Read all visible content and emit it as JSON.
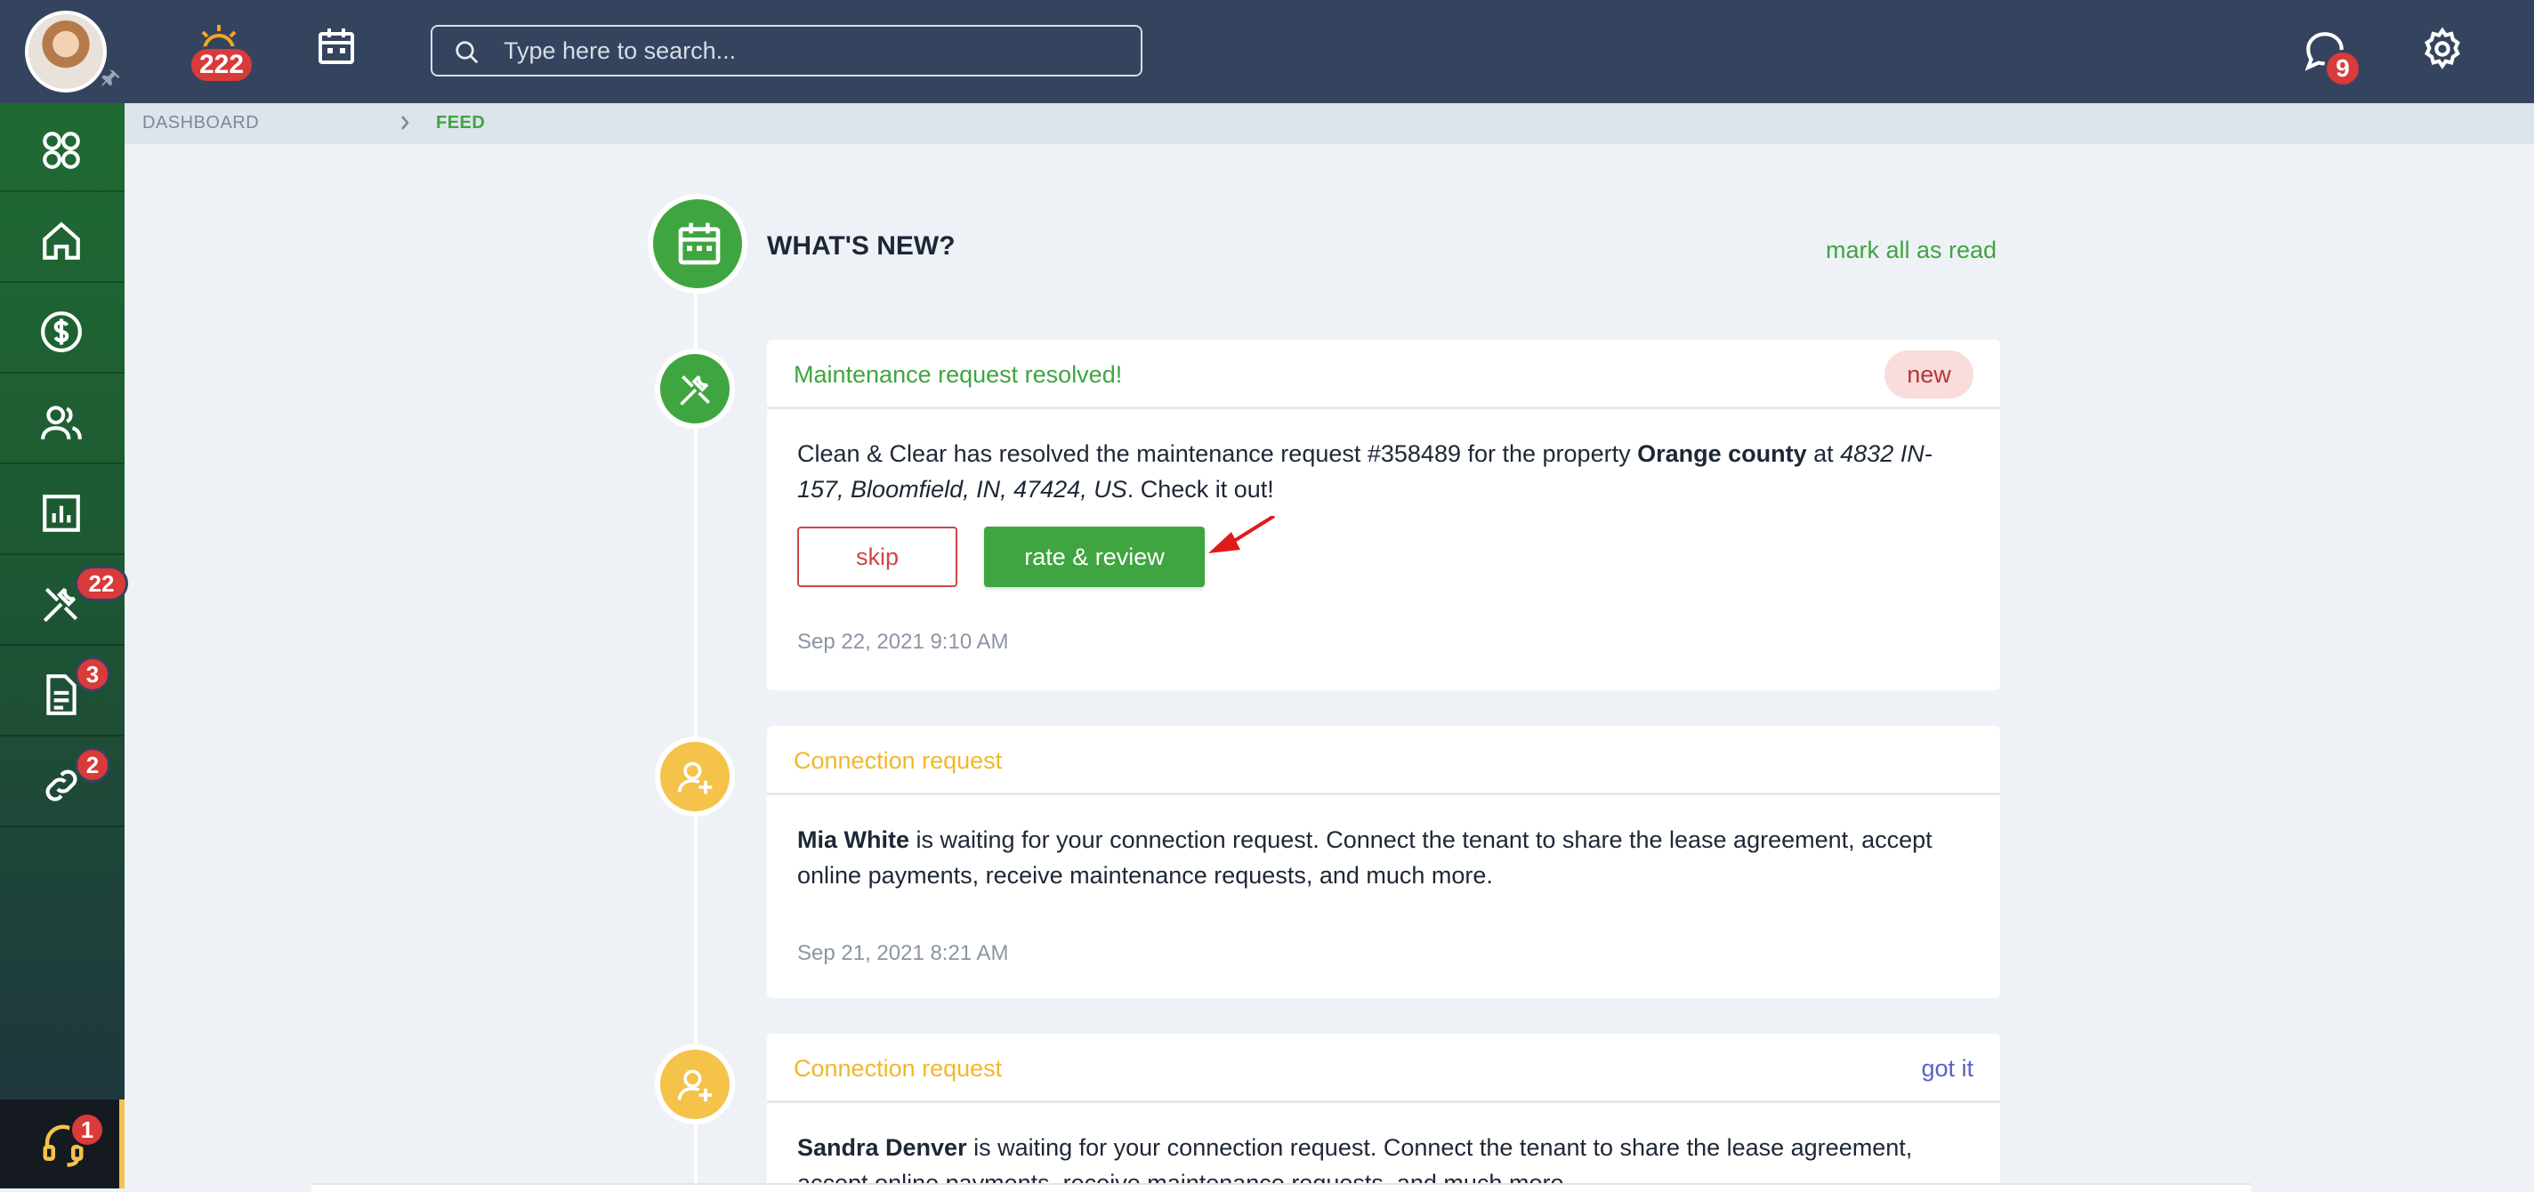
{
  "topbar": {
    "notifications_count": "222",
    "search_placeholder": "Type here to search...",
    "messages_count": "9"
  },
  "sidebar": {
    "items": [
      {
        "name": "dashboard",
        "badge": ""
      },
      {
        "name": "home",
        "badge": ""
      },
      {
        "name": "payments",
        "badge": ""
      },
      {
        "name": "tenants",
        "badge": ""
      },
      {
        "name": "reports",
        "badge": ""
      },
      {
        "name": "maintenance",
        "badge": "22"
      },
      {
        "name": "documents",
        "badge": "3"
      },
      {
        "name": "connections",
        "badge": "2"
      }
    ],
    "support_badge": "1"
  },
  "breadcrumb": {
    "dashboard": "DASHBOARD",
    "feed": "FEED"
  },
  "feed": {
    "title": "WHAT'S NEW?",
    "mark_all_label": "mark all as read",
    "cards": [
      {
        "title": "Maintenance request resolved!",
        "pill": "new",
        "text_1": "Clean & Clear has resolved the maintenance request #358489 for the property ",
        "property": "Orange county",
        "text_2": " at ",
        "address": "4832 IN-157, Bloomfield, IN, 47424, US",
        "text_3": ". Check it out!",
        "skip_label": "skip",
        "rate_label": "rate & review",
        "timestamp": "Sep 22, 2021 9:10 AM"
      },
      {
        "title": "Connection request",
        "name": "Mia White",
        "text": " is waiting for your connection request. Connect the tenant to share the lease agreement, accept online payments, receive maintenance requests, and much more.",
        "timestamp": "Sep 21, 2021 8:21 AM"
      },
      {
        "title": "Connection request",
        "action": "got it",
        "name": "Sandra Denver",
        "text": " is waiting for your connection request. Connect the tenant to share the lease agreement, accept online payments, receive maintenance requests, and much more."
      }
    ]
  },
  "colors": {
    "topbar": "#34445e",
    "accent_green": "#3fa540",
    "accent_yellow": "#f5c24a",
    "badge_red": "#d93a3a"
  }
}
